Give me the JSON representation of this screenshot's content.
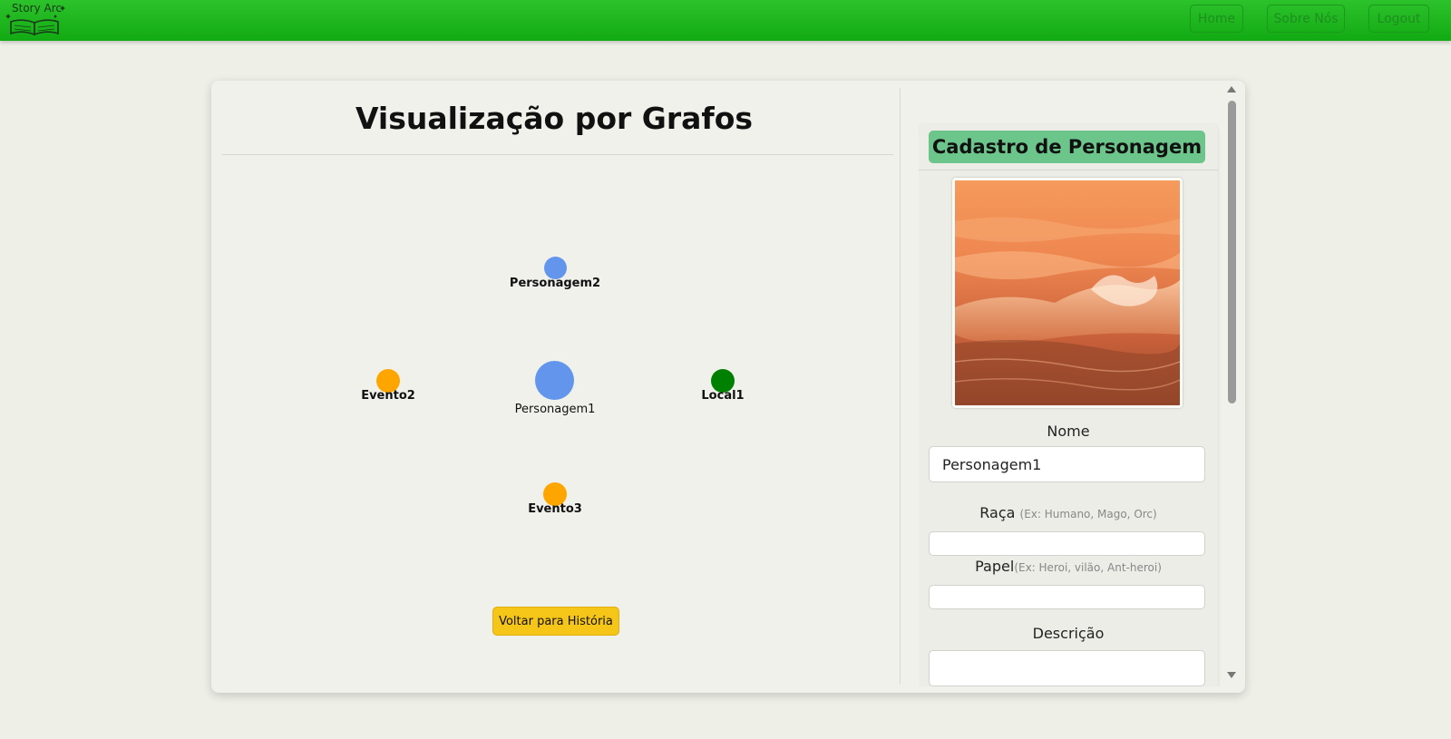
{
  "navbar": {
    "logo_text": "Story Arc",
    "links": [
      {
        "label": "Home"
      },
      {
        "label": "Sobre Nós"
      },
      {
        "label": "Logout"
      }
    ]
  },
  "graph": {
    "title": "Visualização por Grafos",
    "nodes": [
      {
        "id": "personagem2",
        "label": "Personagem2",
        "type": "personagem",
        "color": "#6495ed"
      },
      {
        "id": "personagem1",
        "label": "Personagem1",
        "type": "personagem",
        "color": "#6495ed",
        "selected": true
      },
      {
        "id": "evento2",
        "label": "Evento2",
        "type": "evento",
        "color": "#ffa500"
      },
      {
        "id": "local1",
        "label": "Local1",
        "type": "local",
        "color": "#008000"
      },
      {
        "id": "evento3",
        "label": "Evento3",
        "type": "evento",
        "color": "#ffa500"
      }
    ],
    "back_button": "Voltar para História"
  },
  "form": {
    "header": "Cadastro de Personagem",
    "photo_icon": "ocean-wave-photo",
    "nome_label": "Nome",
    "nome_value": "Personagem1",
    "raca_label": "Raça",
    "raca_hint": "(Ex: Humano, Mago, Orc)",
    "raca_value": "",
    "papel_label": "Papel",
    "papel_hint": "(Ex: Heroi, vilão, Ant-heroi)",
    "papel_value": "",
    "descricao_label": "Descrição",
    "descricao_value": ""
  },
  "colors": {
    "navbar": "#1fb81f",
    "form_header": "#6cc58a",
    "back_button": "#f5c518"
  }
}
